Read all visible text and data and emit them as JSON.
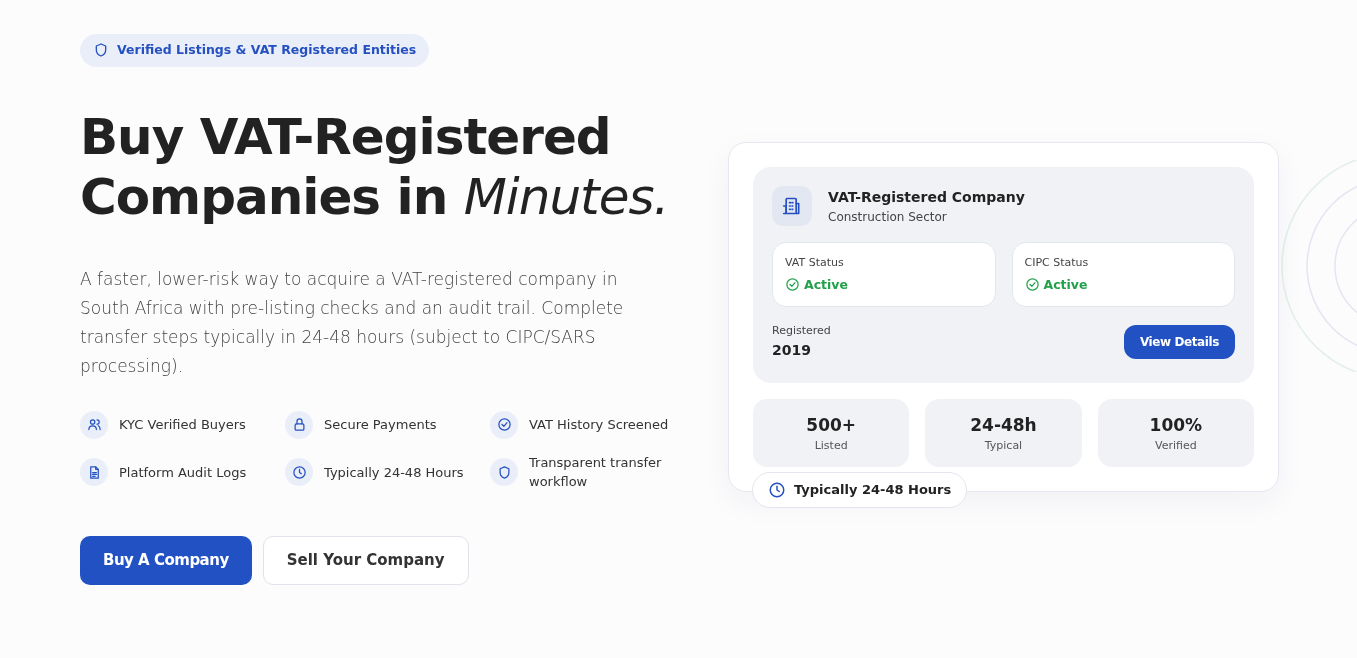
{
  "badge": {
    "kind": "shield",
    "text": "Verified Listings & VAT Registered Entities"
  },
  "headline": {
    "line_1": "Buy VAT-Registered",
    "line_2": "Companies in",
    "emphasis": "Minutes."
  },
  "description": "A faster, lower-risk way to acquire a VAT-registered company in South Africa with pre-listing checks and an audit trail. Complete transfer steps typically in 24-48 hours (subject to CIPC/SARS processing).",
  "features": [
    {
      "kind": "users",
      "label": "KYC Verified Buyers"
    },
    {
      "kind": "lock",
      "label": "Secure Payments"
    },
    {
      "kind": "check",
      "label": "VAT History Screened"
    },
    {
      "kind": "document",
      "label": "Platform Audit Logs"
    },
    {
      "kind": "clock",
      "label": "Typically 24-48 Hours"
    },
    {
      "kind": "shield",
      "label": "Transparent transfer workflow"
    }
  ],
  "buttons": [
    {
      "label": "Buy A Company",
      "kind": "primary"
    },
    {
      "label": "Sell Your Company",
      "kind": "outline"
    }
  ],
  "company_card": {
    "title": "VAT-Registered Company",
    "subtitle": "Construction Sector",
    "statuses": [
      {
        "label": "VAT Status",
        "value": "Active"
      },
      {
        "label": "CIPC Status",
        "value": "Active"
      }
    ],
    "registered_label": "Registered",
    "registered_value": "2019",
    "action": "View Details",
    "stats": [
      {
        "value": "500+",
        "label": "Listed"
      },
      {
        "value": "24-48h",
        "label": "Typical"
      },
      {
        "value": "100%",
        "label": "Verified"
      }
    ],
    "floating_badge": "Typically 24-48 Hours"
  }
}
